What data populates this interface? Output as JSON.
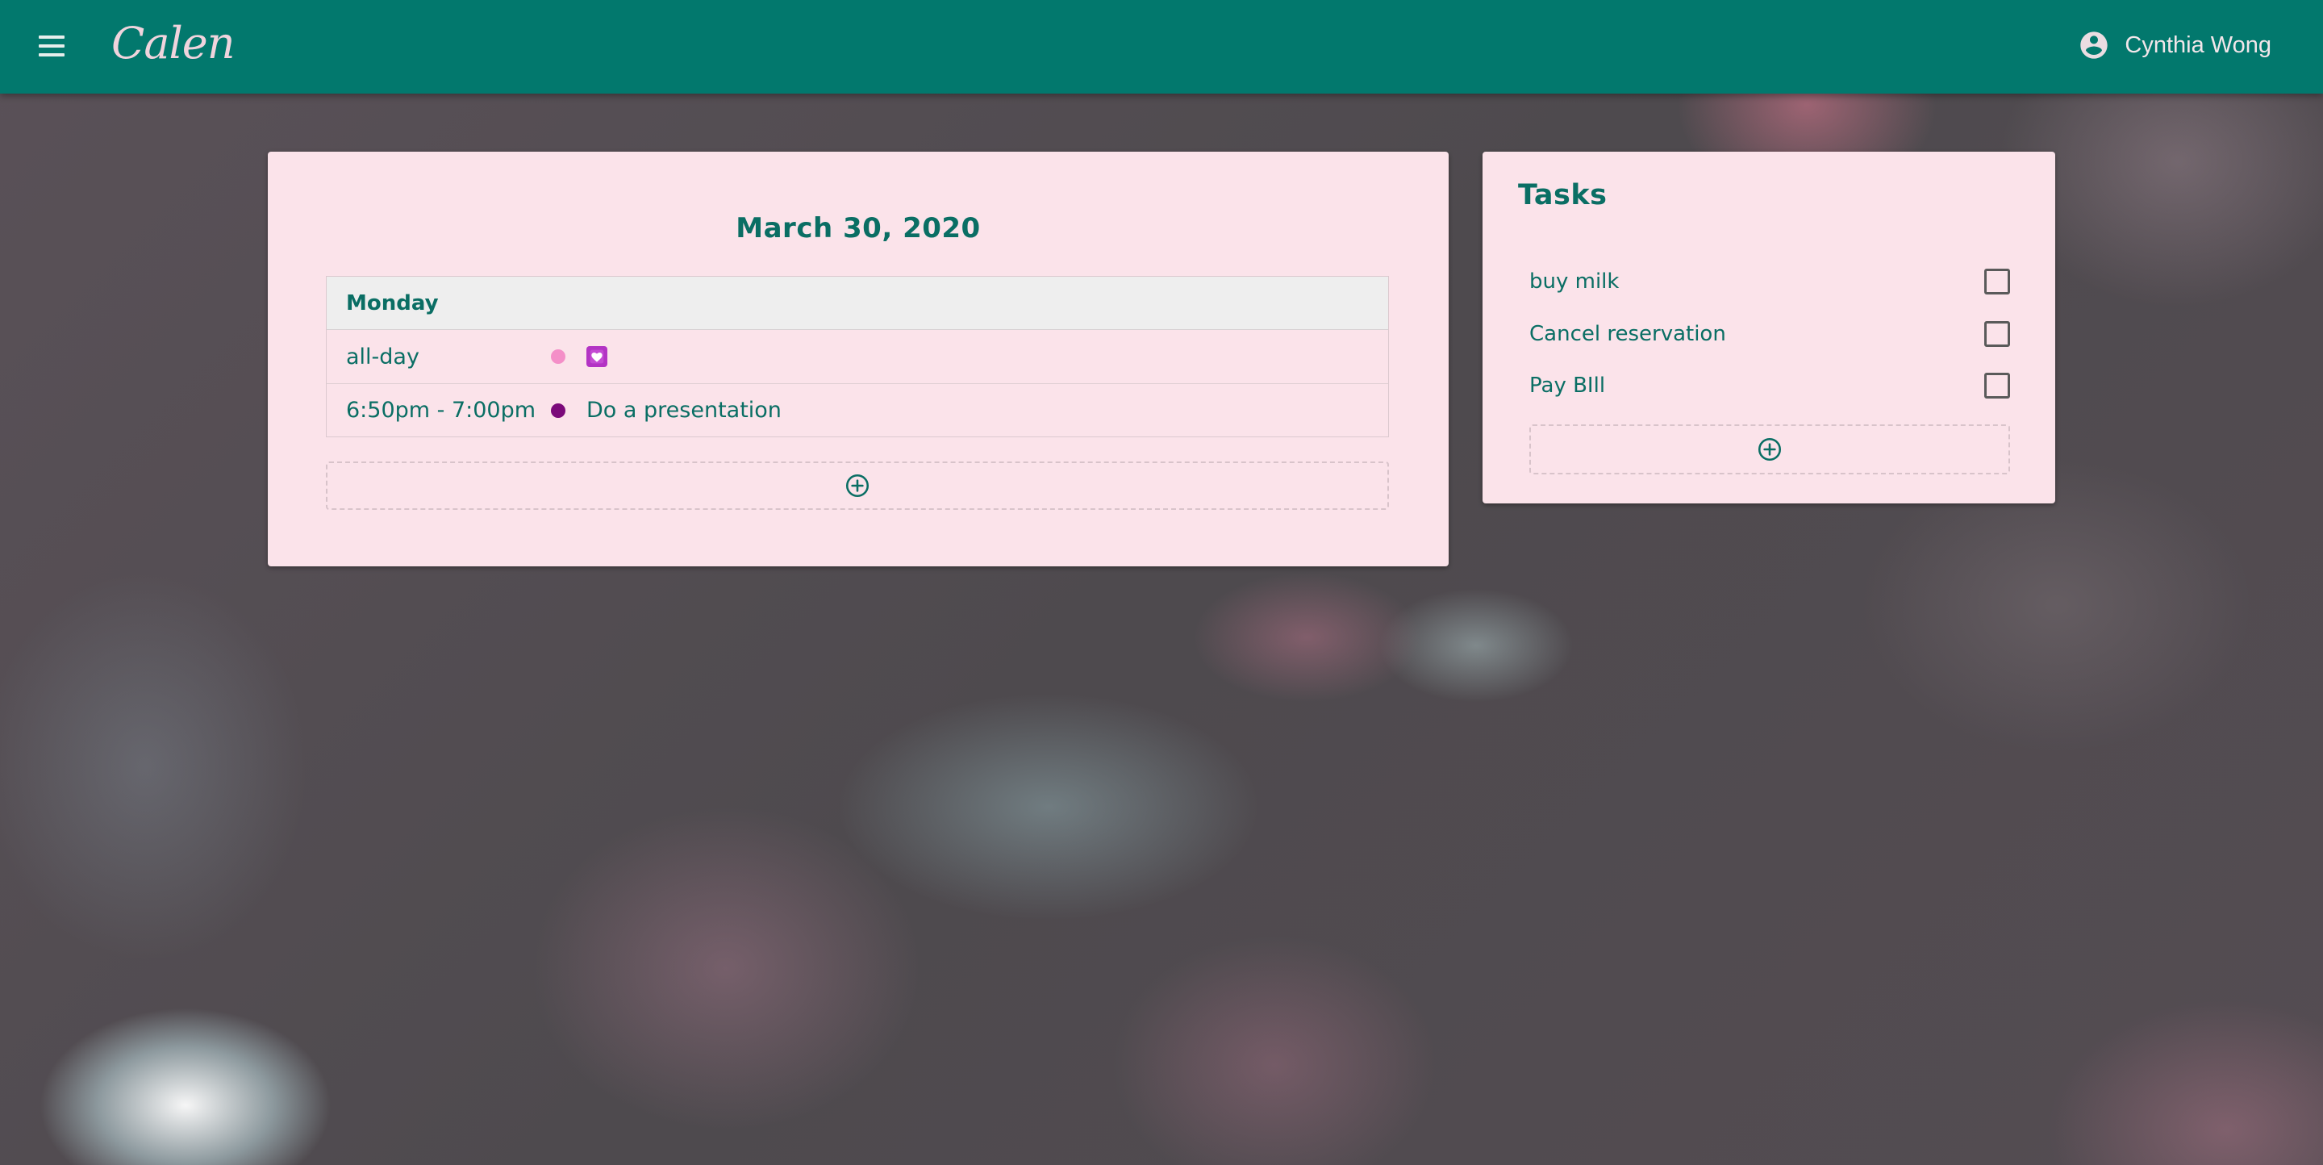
{
  "app": {
    "logo": "Calen",
    "user_name": "Cynthia Wong"
  },
  "schedule": {
    "date_title": "March 30, 2020",
    "day_label": "Monday",
    "events": [
      {
        "time": "all-day",
        "title": "",
        "dot_color": "#f48fc8",
        "icon": "heart-emoji-icon"
      },
      {
        "time": "6:50pm - 7:00pm",
        "title": "Do a presentation",
        "dot_color": "#7b0a7a"
      }
    ]
  },
  "tasks": {
    "title": "Tasks",
    "items": [
      {
        "label": "buy milk",
        "checked": false
      },
      {
        "label": "Cancel reservation",
        "checked": false
      },
      {
        "label": "Pay BIll",
        "checked": false
      }
    ]
  },
  "colors": {
    "appbar": "#02786d",
    "card": "#fbe3ea",
    "accent_text": "#0a6e64"
  }
}
